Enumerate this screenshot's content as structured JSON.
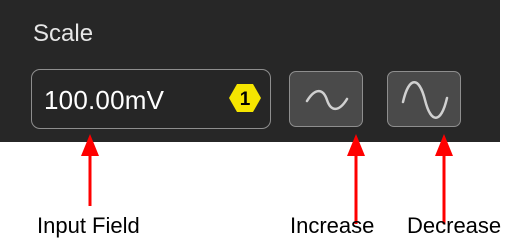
{
  "panel": {
    "title": "Scale",
    "input": {
      "value": "100.00mV",
      "badge": "1"
    },
    "buttons": [
      {
        "icon": "wave-small-icon"
      },
      {
        "icon": "wave-large-icon"
      }
    ]
  },
  "annotations": {
    "input_field": "Input Field",
    "increase": "Increase",
    "decrease": "Decrease"
  },
  "colors": {
    "panel_bg": "#272727",
    "button_bg": "#4a4a4a",
    "border": "#8e8e8e",
    "badge": "#f5e500",
    "arrow": "#ff0000"
  }
}
